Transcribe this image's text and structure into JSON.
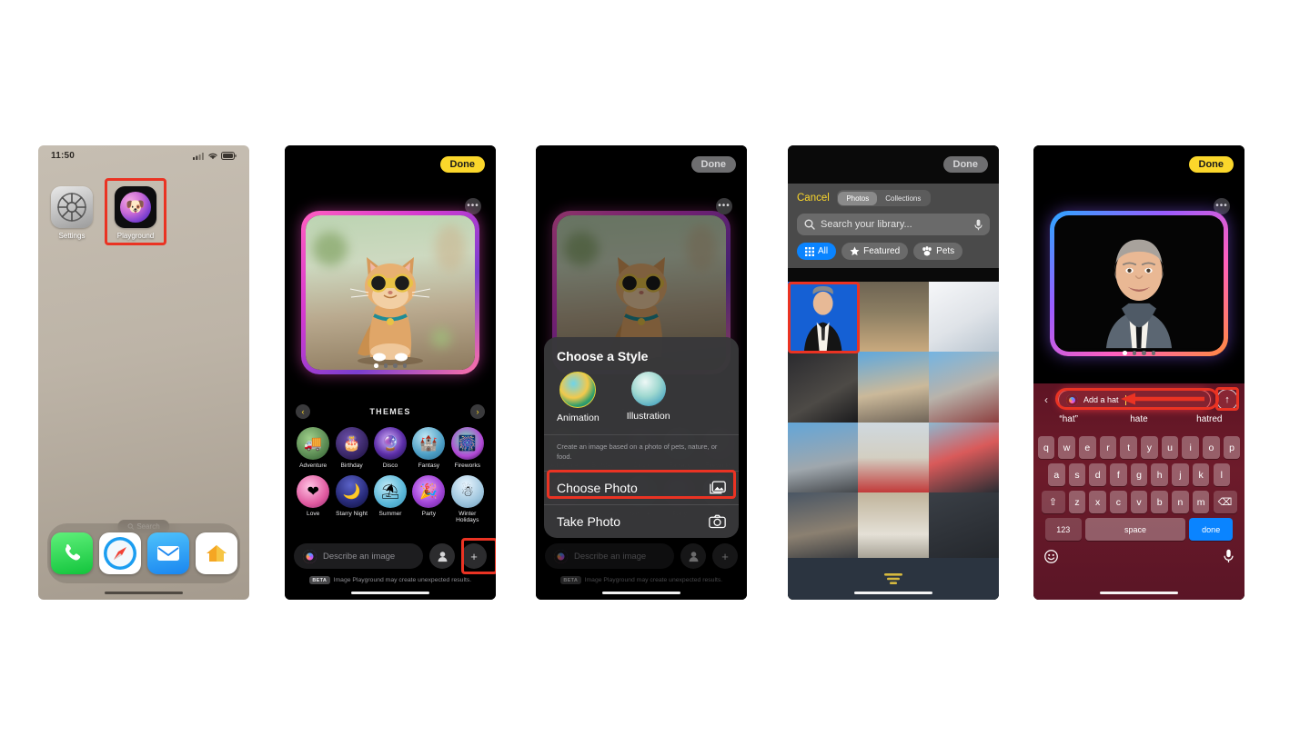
{
  "phone1": {
    "name": "home-screen",
    "status": {
      "time": "11:50",
      "cellular": "cellular-icon",
      "wifi": "wifi-icon",
      "battery": "battery-icon"
    },
    "apps": [
      {
        "label": "Settings",
        "icon": "settings-gear-icon"
      },
      {
        "label": "Playground",
        "icon": "image-playground-icon"
      }
    ],
    "search_pill": {
      "label": "Search",
      "icon": "search-icon"
    },
    "dock": [
      {
        "label": "Phone",
        "icon": "phone-icon"
      },
      {
        "label": "Safari",
        "icon": "safari-compass-icon"
      },
      {
        "label": "Mail",
        "icon": "mail-envelope-icon"
      },
      {
        "label": "Home",
        "icon": "home-house-icon"
      }
    ],
    "highlight": "playground-app-highlight"
  },
  "phone2": {
    "name": "image-playground-themes",
    "done_label": "Done",
    "more_icon": "more-dots-icon",
    "image_alt": "cat-with-sunglasses-generated-image",
    "page_dots": {
      "count": 4,
      "active": 0
    },
    "themes_header": {
      "title": "THEMES",
      "prev_icon": "chevron-left-icon",
      "next_icon": "chevron-right-icon"
    },
    "themes": [
      {
        "label": "Adventure",
        "glyph": "🚚"
      },
      {
        "label": "Birthday",
        "glyph": "🎂"
      },
      {
        "label": "Disco",
        "glyph": "🔮"
      },
      {
        "label": "Fantasy",
        "glyph": "🏰"
      },
      {
        "label": "Fireworks",
        "glyph": "🎆"
      },
      {
        "label": "Love",
        "glyph": "❤"
      },
      {
        "label": "Starry Night",
        "glyph": "🌙"
      },
      {
        "label": "Summer",
        "glyph": "⛱"
      },
      {
        "label": "Party",
        "glyph": "🎉"
      },
      {
        "label": "Winter Holidays",
        "glyph": "☃"
      }
    ],
    "input": {
      "placeholder": "Describe an image",
      "orb_icon": "playground-orb-icon"
    },
    "person_button_icon": "person-icon",
    "add_button_icon": "plus-icon",
    "beta": {
      "tag": "BETA",
      "text": "Image Playground may create unexpected results."
    },
    "highlight": "add-button-highlight"
  },
  "phone3": {
    "name": "choose-a-style-sheet",
    "done_label": "Done",
    "more_icon": "more-dots-icon",
    "sheet_title": "Choose a Style",
    "styles": [
      {
        "label": "Animation",
        "icon": "animation-style-icon"
      },
      {
        "label": "Illustration",
        "icon": "illustration-style-icon"
      }
    ],
    "note": "Create an image based on a photo of pets, nature, or food.",
    "actions": [
      {
        "label": "Choose Photo",
        "icon": "photo-library-icon",
        "highlighted": true
      },
      {
        "label": "Take Photo",
        "icon": "camera-icon",
        "highlighted": false
      }
    ],
    "input": {
      "placeholder": "Describe an image",
      "orb_icon": "playground-orb-icon"
    },
    "person_button_icon": "person-icon",
    "add_button_icon": "plus-icon",
    "beta": {
      "tag": "BETA",
      "text": "Image Playground may create unexpected results."
    },
    "highlight": "choose-photo-highlight"
  },
  "phone4": {
    "name": "photo-picker",
    "done_label": "Done",
    "cancel_label": "Cancel",
    "segments": [
      {
        "label": "Photos",
        "active": true
      },
      {
        "label": "Collections",
        "active": false
      }
    ],
    "search": {
      "placeholder": "Search your library...",
      "icon": "search-icon",
      "mic_icon": "microphone-icon"
    },
    "chips": [
      {
        "label": "All",
        "icon": "grid-icon",
        "active": true
      },
      {
        "label": "Featured",
        "icon": "star-icon",
        "active": false
      },
      {
        "label": "Pets",
        "icon": "paw-icon",
        "active": false
      }
    ],
    "sort_icon": "sort-filter-icon",
    "highlight": "selected-photo-highlight"
  },
  "phone5": {
    "name": "prompt-keyboard",
    "done_label": "Done",
    "more_icon": "more-dots-icon",
    "image_alt": "animated-portrait-of-man-in-suit",
    "page_dots": {
      "count": 4,
      "active": 0
    },
    "prompt": {
      "back_icon": "chevron-left-icon",
      "orb_icon": "playground-orb-icon",
      "value": "Add a hat",
      "send_icon": "arrow-up-circle-icon"
    },
    "suggestions": [
      "“hat”",
      "hate",
      "hatred"
    ],
    "keyboard": {
      "row1": [
        "q",
        "w",
        "e",
        "r",
        "t",
        "y",
        "u",
        "i",
        "o",
        "p"
      ],
      "row2": [
        "a",
        "s",
        "d",
        "f",
        "g",
        "h",
        "j",
        "k",
        "l"
      ],
      "row3": [
        "z",
        "x",
        "c",
        "v",
        "b",
        "n",
        "m"
      ],
      "shift_icon": "shift-icon",
      "delete_icon": "delete-backspace-icon",
      "numbers_label": "123",
      "space_label": "space",
      "done_label": "done",
      "emoji_icon": "emoji-icon",
      "dictation_icon": "microphone-icon"
    },
    "highlights": [
      "prompt-field-highlight",
      "send-button-highlight"
    ],
    "annotation_arrow": "red-arrow-pointing-left"
  },
  "colors": {
    "accent_yellow": "#fbd72b",
    "highlight_red": "#ea3323",
    "ios_blue": "#0a84ff",
    "page_background": "#ffffff"
  }
}
